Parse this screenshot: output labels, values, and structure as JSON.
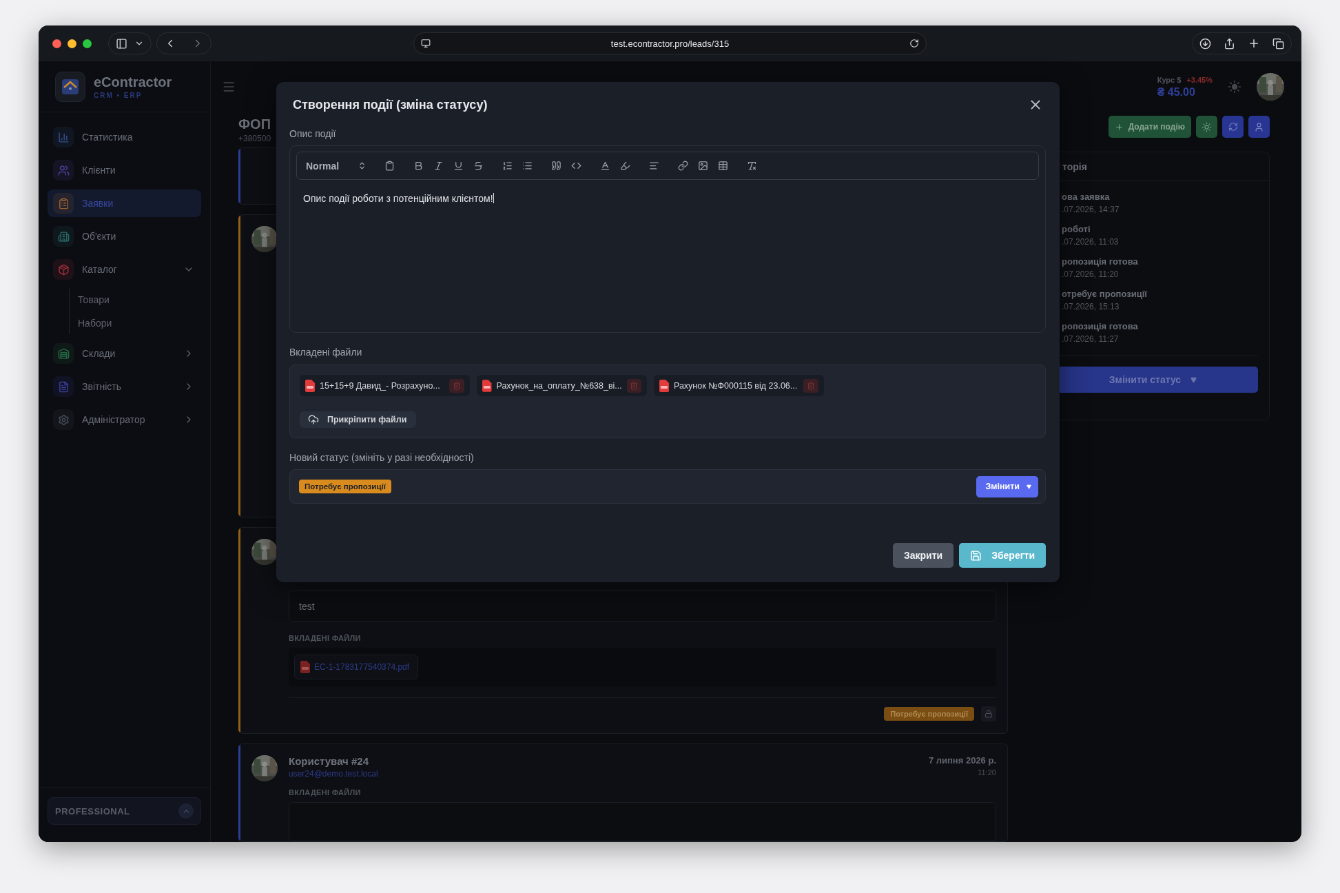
{
  "browser": {
    "url": "test.econtractor.pro/leads/315"
  },
  "sidebar": {
    "brand": "eContractor",
    "tagline": "CRM • ERP",
    "items": [
      {
        "label": "Статистика",
        "kind": "link",
        "selected": false
      },
      {
        "label": "Клієнти",
        "kind": "link",
        "selected": false
      },
      {
        "label": "Заявки",
        "kind": "link",
        "selected": true
      },
      {
        "label": "Об'єкти",
        "kind": "link",
        "selected": false
      },
      {
        "label": "Каталог",
        "kind": "group",
        "selected": false,
        "expanded": true,
        "children": [
          {
            "label": "Товари"
          },
          {
            "label": "Набори"
          }
        ]
      },
      {
        "label": "Склади",
        "kind": "group",
        "selected": false,
        "expanded": false
      },
      {
        "label": "Звітність",
        "kind": "group",
        "selected": false,
        "expanded": false
      },
      {
        "label": "Адміністратор",
        "kind": "group",
        "selected": false,
        "expanded": false
      }
    ],
    "plan": "PROFESSIONAL"
  },
  "header": {
    "rate_label": "Курс $",
    "rate_change": "+3.45%",
    "rate": "₴ 45.00"
  },
  "lead": {
    "title": "ФОП",
    "phone": "+380500"
  },
  "actions": {
    "add_event": "Додати подію"
  },
  "events": [
    {
      "color": "#2f3d92"
    },
    {
      "color": "#946118",
      "avatar": true
    },
    {
      "color": "#946118",
      "avatar": true,
      "description": "test",
      "files_label": "ВКЛАДЕНІ ФАЙЛИ",
      "files": [
        "EC-1-1783177540374.pdf"
      ],
      "status": "Потребує пропозиції",
      "locked": true
    },
    {
      "color": "#2f3d92",
      "avatar": true,
      "author": "Користувач #24",
      "email": "user24@demo.test.local",
      "date": "7 липня 2026 р.",
      "time": "11:20",
      "files_label": "ВКЛАДЕНІ ФАЙЛИ"
    }
  ],
  "history": {
    "title": "торія",
    "items": [
      {
        "status": "ова заявка",
        "time": ".07.2026, 14:37"
      },
      {
        "status": "роботі",
        "time": ".07.2026, 11:03"
      },
      {
        "status": "ропозиція готова",
        "time": ".07.2026, 11:20"
      },
      {
        "status": "отребує пропозиції",
        "time": ".07.2026, 15:13"
      },
      {
        "status": "ропозиція готова",
        "time": ".07.2026, 11:27"
      }
    ],
    "change_button": "Змінити статус"
  },
  "modal": {
    "title": "Створення події (зміна статусу)",
    "description_label": "Опис події",
    "format": "Normal",
    "description": "Опис події роботи з потенційним клієнтом!",
    "files_label": "Вкладені файли",
    "files": [
      {
        "name": "15+15+9 Давид_- Розрахуно..."
      },
      {
        "name": "Рахунок_на_оплату_№638_ві..."
      },
      {
        "name": "Рахунок №Ф000115 від 23.06..."
      }
    ],
    "attach_button": "Прикріпити файли",
    "status_label": "Новий статус (змініть у разі необхідності)",
    "status": "Потребує пропозиції",
    "change_button": "Змінити",
    "buttons": [
      {
        "label": "Закрити",
        "kind": "secondary"
      },
      {
        "label": "Зберегти",
        "kind": "primary"
      }
    ]
  }
}
